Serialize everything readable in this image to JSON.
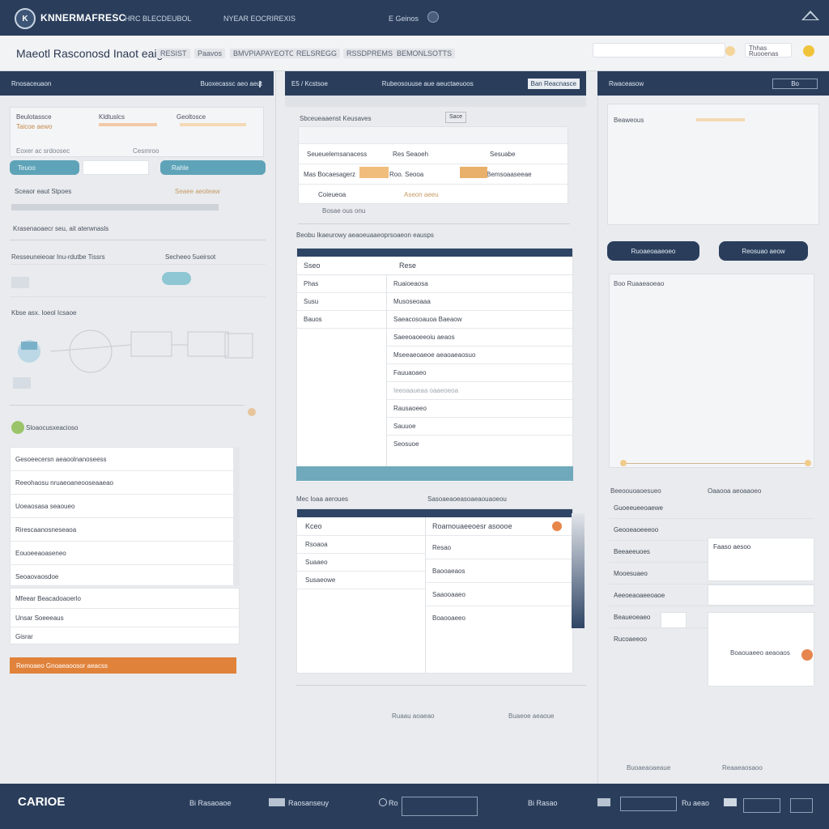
{
  "header": {
    "logo_text": "K",
    "brand": "KNNERMAFRESC",
    "nav": [
      "HRC BLECDEUBOL",
      "NYEAR EOCRIREXIS",
      "E Geinos"
    ]
  },
  "subheader": {
    "title": "Maeotl Rasconosd Inaot eaignts",
    "filters": [
      "RESIST",
      "Paavos",
      "BMVPIAPAYEOTOS",
      "RELSREGG",
      "RSSDPREMS",
      "BEMONLSOTTS"
    ],
    "user_label": "Thhas",
    "user_sub": "Ruooenas"
  },
  "left": {
    "header_left": "Rnosaceuaon",
    "header_right": "Buoxecassc aeo aeut",
    "summary": {
      "col1_title": "Beulotassce",
      "col1_sub": "Taicoe aewo",
      "col2_title": "Kldtuslcs",
      "col3_title": "Geoltosce",
      "footnote1": "Eoxer ac srdoosec",
      "footnote2": "Cesmroo"
    },
    "teal_button": "Teuoo",
    "teal_button2": "Rahle",
    "section1": "Sceaor eaut Stpoes",
    "section1b": "Seaee aeoteaw",
    "section2": "Krasenaoaecr seu, ait aterwnasls",
    "section3": "Resseuneieoar Inu-rdutbe Tissrs",
    "section3b": "Secheeo 5ueirsot",
    "diagram_label": "Kbse asx. Ioeol Icsaoe",
    "list_title": "Sloaocusxeacioso",
    "list_rows": [
      "Gesoeecersn aeaoolnanoseess",
      "Reeohaosu nruaeoaneooseaaeao",
      "Uoeaosasa seaoueo",
      "Rirescaanosneseaoa",
      "Eouoeeaoaseneo",
      "Seoaovaosdoe"
    ],
    "sub_title": "Mfeear Beacadoaoerlo",
    "sub_rows": [
      "Unsar Soeeeaus",
      "Gisrar"
    ],
    "orange_bar": "Remoaeo Gnoaeaoosor aeacss"
  },
  "center": {
    "header_left": "E5 / Kcstsoe",
    "header_mid": "Rubeosouuse aue aeuctaeuoos",
    "header_right": "Ban Reacnasce",
    "card_title": "Sbceueaaenst Keusaves",
    "card_tag": "Sace",
    "card_rows": [
      [
        "Seueuelemsanacess",
        "Res Seaoeh",
        "Sesuabe"
      ],
      [
        "Mas Bocaesagerz",
        "Roo. Seooa",
        "Bemsoaaseeae"
      ],
      [
        "Coieueoa",
        "Aseon aeeu",
        ""
      ]
    ],
    "card_foot": "Bosae ous onu",
    "section_title": "Beobu Ikaeurowy aeaoeuaaeoprsoaeon eausps",
    "table1": {
      "col_a": "Sseo",
      "col_b": "Rese",
      "left_rows": [
        "Phas",
        "Susu",
        "Bauos"
      ],
      "right_rows": [
        "Ruaioeaosa",
        "Musoseoaaa",
        "Saeacosoauoa Baeaow",
        "Saeeoaoeeoiu aeaos",
        "Mseeaeoaeoe aeaoaeaosuo",
        "Fauuaoaeo",
        "Ieeoaaueaa oaaeoeoa",
        "Rausaoeeo",
        "Sauuoe",
        "Seosuoe"
      ]
    },
    "section2_left": "Mec Ioaa aeroues",
    "section2_right": "Sasoaeaoeasoaeaouaoeou",
    "table2": {
      "col_a": "Kceo",
      "col_b": "Roamouaeeoesr asoooe",
      "left_rows": [
        "Rsoaoa",
        "Suaaeo",
        "Susaeowe"
      ],
      "right_rows": [
        "Resao",
        "Baooaeaos",
        "Saaooaaeo",
        "Boaooaeeo"
      ]
    },
    "foot_rows": [
      "Ruaau aoaeao",
      "Buaeoe aeaoue"
    ]
  },
  "right": {
    "header_left": "Rwaceasow",
    "header_right": "Bo",
    "line1": "Beaweous",
    "btn_primary": "Ruoaeoaaeoeo",
    "btn_secondary": "Reosuao aeow",
    "list_head": "Boo Ruaaeaoeao",
    "form_title_left": "Beeoouoaoesueo",
    "form_title_right": "Oaaooa aeoaaoeo",
    "form_rows": [
      "Guoeeueeoaewe",
      "Geooeaoeeeoo",
      "Beeaeeuoes",
      "Mooesuaeo",
      "Aeeoeaoaeeoaoe",
      "Beaueoeaeo",
      "Rucoaeeoo"
    ],
    "input_value": "Faaso aesoo",
    "action_label": "Boaouaeeo aeaoaos",
    "foot_left": "Buoaeaoaeaue",
    "foot_right": "Reaaeaosaoo"
  },
  "footer": {
    "logo": "CARIOE",
    "items": [
      "Bi Rasaoaoe",
      "Raosanseuy",
      "Ro",
      "Bi Rasao",
      "Ru aeao"
    ]
  },
  "colors": {
    "navy": "#2a3e5c",
    "teal": "#5fa3b8",
    "orange": "#e0823a",
    "amber": "#f0c060"
  }
}
